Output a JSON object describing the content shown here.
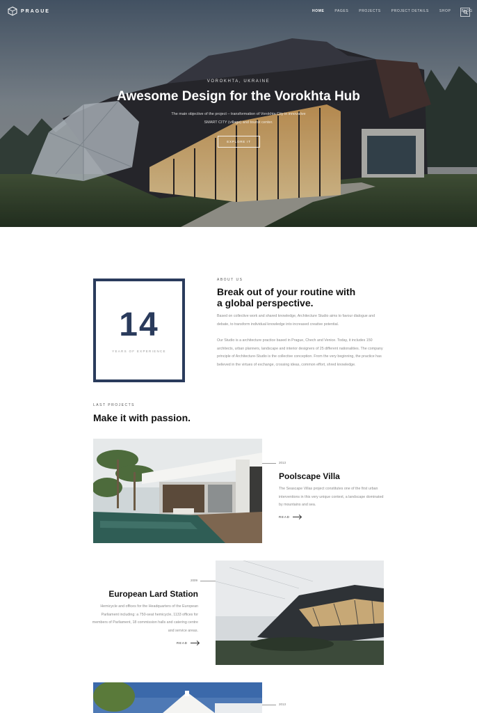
{
  "brand": {
    "name": "PRAGUE"
  },
  "nav": {
    "items": [
      "HOME",
      "PAGES",
      "PROJECTS",
      "PROJECT DETAILS",
      "SHOP",
      "BLOG"
    ],
    "active": "HOME"
  },
  "hero": {
    "kicker": "VOROKHTA, UKRAINE",
    "title": "Awesome Design for the Vorokhta Hub",
    "subtitle_line1": "The main objective of the project – transformation of Vorokhta City in innovative",
    "subtitle_line2": "SMART CITY (village) and tourist center.",
    "button": "EXPLORE IT"
  },
  "about": {
    "years": "14",
    "years_label": "YEARS OF EXPERIENCE",
    "kicker": "ABOUT US",
    "title_line1": "Break out of your routine with",
    "title_line2": "a global perspective.",
    "para1": "Based on collective work and shared knowledge, Architecture Studio aims to favour dialogue and debate, to transform individual knowledge into increased creative potential.",
    "para2": "Our Studio is a architecture practice based in Prague, Chech and Venice. Today, it includes 150 architects, urban planners, landscape and interior designers of 25 different nationalities. The company principle of Architecture-Studio is the collective conception. From the very beginning, the practice has believed in the virtues of exchange, crossing ideas, common effort, shred knowledge."
  },
  "projects": {
    "kicker": "LAST PROJECTS",
    "title": "Make it with passion.",
    "items": [
      {
        "year": "2013",
        "name": "Poolscape Villa",
        "desc": "The Seascape Villas project constitutes one of the first urban interventions in this very unique context, a landscape dominated by mountains and sea.",
        "read": "READ"
      },
      {
        "year": "2009",
        "name": "European Lard Station",
        "desc": "Hemicycle and offices for the Headquarters of the European Parliament including: a 750-seat hemicycle, 1133 offices for members of Parliament, 18 commission halls and catering centre and service areas.",
        "read": "READ"
      },
      {
        "year": "2013"
      }
    ]
  },
  "colors": {
    "accent": "#2a3b5c",
    "text_dark": "#111111",
    "text_muted": "#8a8a8a"
  }
}
